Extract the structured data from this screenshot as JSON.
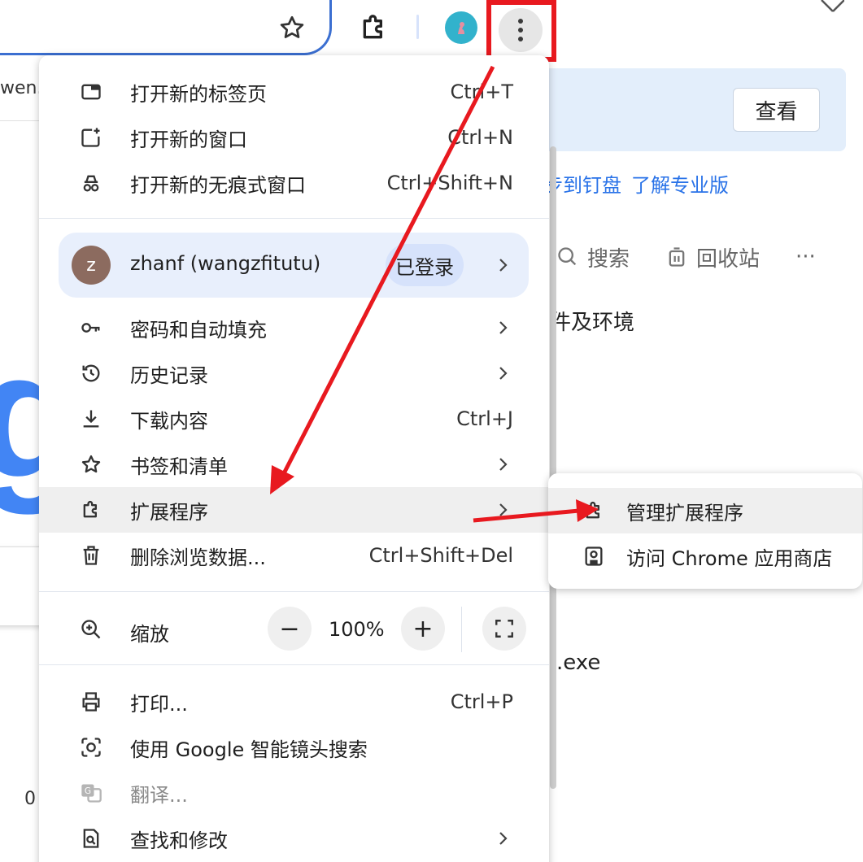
{
  "toolbar": {
    "star_icon": "star-icon",
    "extensions_icon": "puzzle-icon",
    "menu_icon": "three-dots-vertical-icon",
    "close_icon": "close-icon"
  },
  "background": {
    "bookmark_text": "wen..",
    "banner_button": "查看",
    "pin_links": [
      "步到钉盘",
      "了解专业版"
    ],
    "search_label": "搜索",
    "recycle_label": "回收站",
    "more_label": "···",
    "env_text": "件及环境",
    "exe_text": ".exe",
    "zero_text": "0",
    "google_letter": "g"
  },
  "menu": {
    "new_tab": {
      "label": "打开新的标签页",
      "shortcut": "Ctrl+T"
    },
    "new_window": {
      "label": "打开新的窗口",
      "shortcut": "Ctrl+N"
    },
    "incognito": {
      "label": "打开新的无痕式窗口",
      "shortcut": "Ctrl+Shift+N"
    },
    "profile": {
      "initial": "z",
      "name": "zhanf (wangzfitutu)",
      "status": "已登录"
    },
    "passwords": {
      "label": "密码和自动填充"
    },
    "history": {
      "label": "历史记录"
    },
    "downloads": {
      "label": "下载内容",
      "shortcut": "Ctrl+J"
    },
    "bookmarks": {
      "label": "书签和清单"
    },
    "extensions": {
      "label": "扩展程序"
    },
    "clear_data": {
      "label": "删除浏览数据...",
      "shortcut": "Ctrl+Shift+Del"
    },
    "zoom": {
      "label": "缩放",
      "minus": "−",
      "value": "100%",
      "plus": "+"
    },
    "print": {
      "label": "打印...",
      "shortcut": "Ctrl+P"
    },
    "lens": {
      "label": "使用 Google 智能镜头搜索"
    },
    "translate": {
      "label": "翻译..."
    },
    "find": {
      "label": "查找和修改"
    }
  },
  "submenu": {
    "manage": {
      "label": "管理扩展程序"
    },
    "store": {
      "label": "访问 Chrome 应用商店"
    }
  },
  "colors": {
    "annotation_red": "#e8191f",
    "omnibox_border": "#3b6fd1",
    "profile_bg": "#e8effc",
    "hover_bg": "#efefef"
  }
}
